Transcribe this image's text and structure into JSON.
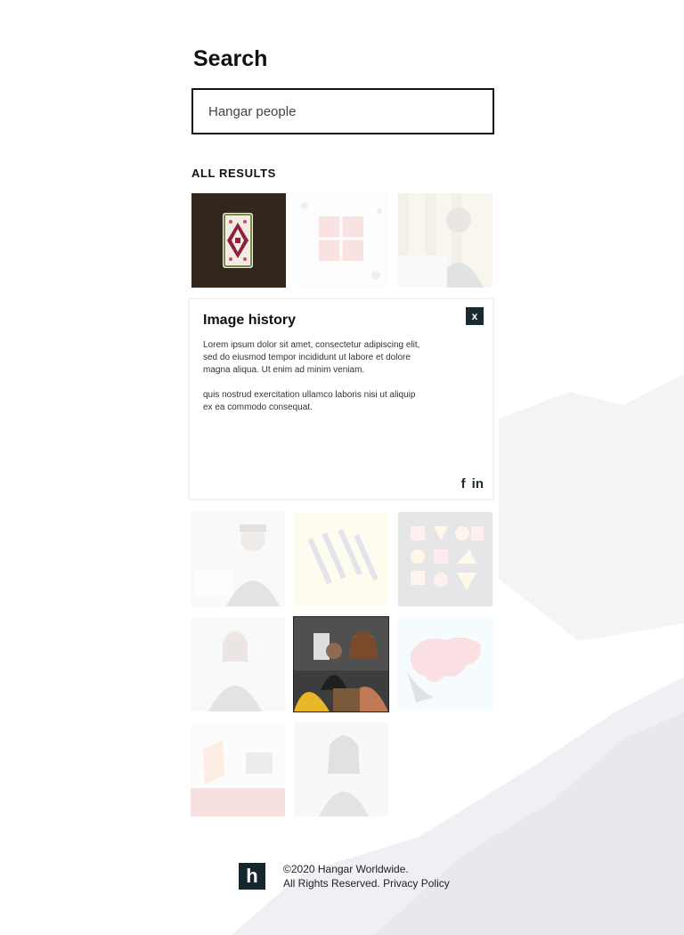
{
  "search": {
    "title": "Search",
    "query": "Hangar people"
  },
  "results": {
    "heading": "ALL RESULTS"
  },
  "image_history": {
    "title": "Image history",
    "close_label": "x",
    "paragraph_1": "Lorem ipsum dolor sit amet, consectetur adipiscing elit, sed do eiusmod tempor incididunt ut labore et dolore magna aliqua. Ut enim ad minim veniam.",
    "paragraph_2": "quis nostrud exercitation ullamco laboris nisi ut aliquip ex ea commodo consequat.",
    "social": {
      "facebook": "f",
      "linkedin": "in"
    }
  },
  "footer": {
    "logo": "h",
    "copyright": "©2020 Hangar Worldwide.",
    "rights": "All Rights Reserved.",
    "privacy_link": "Privacy Policy"
  },
  "colors": {
    "dark_navy": "#1a2a33",
    "border": "#111111"
  },
  "icons": {
    "close": "close-icon",
    "facebook": "facebook-icon",
    "linkedin": "linkedin-icon",
    "logo": "hangar-logo"
  }
}
